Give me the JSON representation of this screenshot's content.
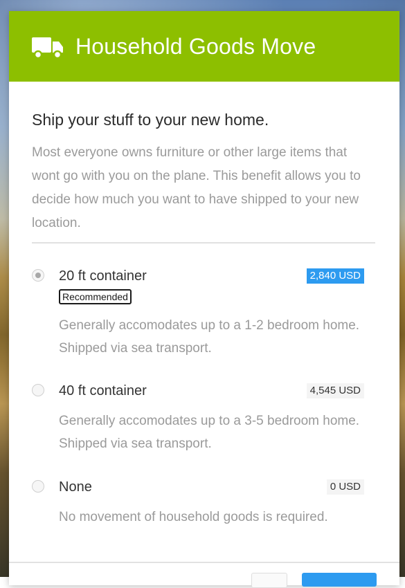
{
  "header": {
    "title": "Household Goods Move",
    "icon": "truck-icon",
    "color": "#8dbf00"
  },
  "content": {
    "subtitle": "Ship your stuff to your new home.",
    "intro": "Most everyone owns furniture or other large items that wont go with you on the plane. This benefit allows you to decide how much you want to have shipped to your new location."
  },
  "options": [
    {
      "title": "20 ft container",
      "price": "2,840 USD",
      "badge": "Recommended",
      "selected": true,
      "description": "Generally accomodates up to a 1-2 bedroom home. Shipped via sea transport."
    },
    {
      "title": "40 ft container",
      "price": "4,545 USD",
      "selected": false,
      "description": "Generally accomodates up to a 3-5 bedroom home. Shipped via sea transport."
    },
    {
      "title": "None",
      "price": "0 USD",
      "selected": false,
      "description": "No movement of household goods is required."
    }
  ],
  "colors": {
    "accent": "#2d9bf0",
    "muted_text": "#9a9a9a"
  }
}
